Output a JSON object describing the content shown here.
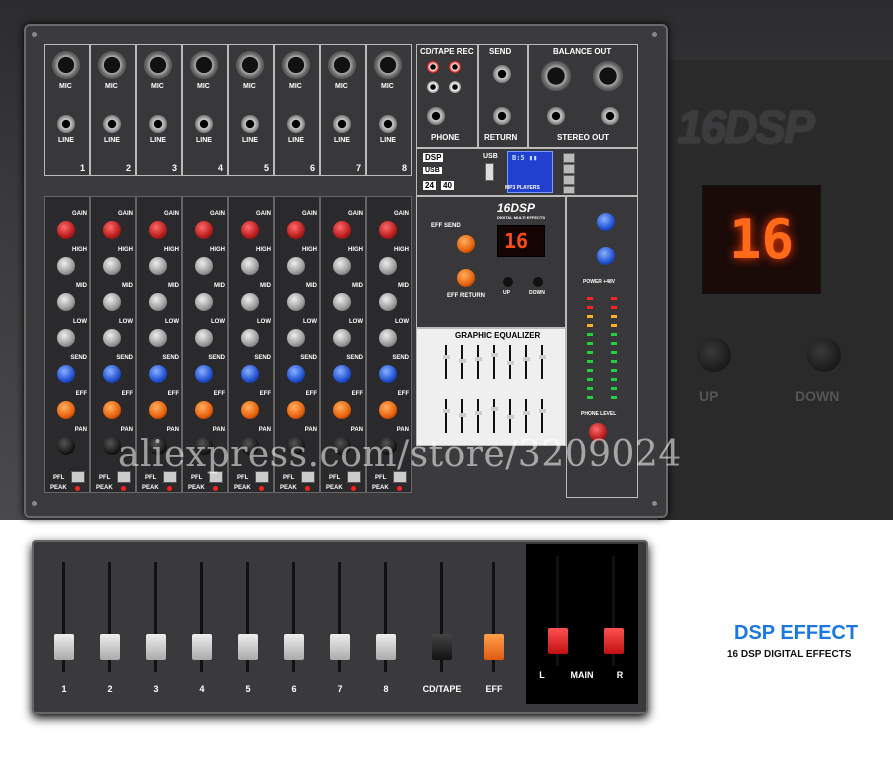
{
  "zoom_panel": {
    "logo": "16DSP",
    "display": "16",
    "up": "UP",
    "down": "DOWN"
  },
  "channels": [
    {
      "num": "1"
    },
    {
      "num": "2"
    },
    {
      "num": "3"
    },
    {
      "num": "4"
    },
    {
      "num": "5"
    },
    {
      "num": "6"
    },
    {
      "num": "7"
    },
    {
      "num": "8"
    }
  ],
  "labels": {
    "mic": "MIC",
    "line": "LINE",
    "cdtape_rec": "CD/TAPE REC",
    "phone": "PHONE",
    "send": "SEND",
    "return": "RETURN",
    "balance_out": "BALANCE OUT",
    "stereo_out": "STEREO OUT",
    "l": "L",
    "r": "R",
    "in": "IN",
    "out": "OUT",
    "usb": "USB",
    "mp3": "MP3 PLAYERS",
    "dsp": "DSP",
    "bit": "24",
    "bit2": "40",
    "gain": "GAIN",
    "high": "HIGH",
    "mid": "MID",
    "low": "LOW",
    "eff": "EFF",
    "pan": "PAN",
    "pfl": "PFL",
    "peak": "PEAK",
    "dsp_logo": "16DSP",
    "dsp_sub": "DIGITAL MULTI EFFECTS",
    "eff_send": "EFF SEND",
    "eff_return": "EFF RETURN",
    "up": "UP",
    "down": "DOWN",
    "dsp_display": "16",
    "graphic_eq": "GRAPHIC EQUALIZER",
    "power": "POWER +48V",
    "phone_level": "PHONE LEVEL"
  },
  "faders": {
    "channels": [
      "1",
      "2",
      "3",
      "4",
      "5",
      "6",
      "7",
      "8"
    ],
    "cdtape": "CD/TAPE",
    "eff": "EFF",
    "main": "MAIN",
    "l": "L",
    "r": "R"
  },
  "colors": {
    "gain": "#b81c1c",
    "send": "#2050d0",
    "eff": "#e8600a",
    "promo": "#1a78e0"
  },
  "watermark": "aliexpress.com/store/3209024",
  "promo": {
    "title": "DSP EFFECT",
    "subtitle": "16 DSP DIGITAL EFFECTS"
  }
}
